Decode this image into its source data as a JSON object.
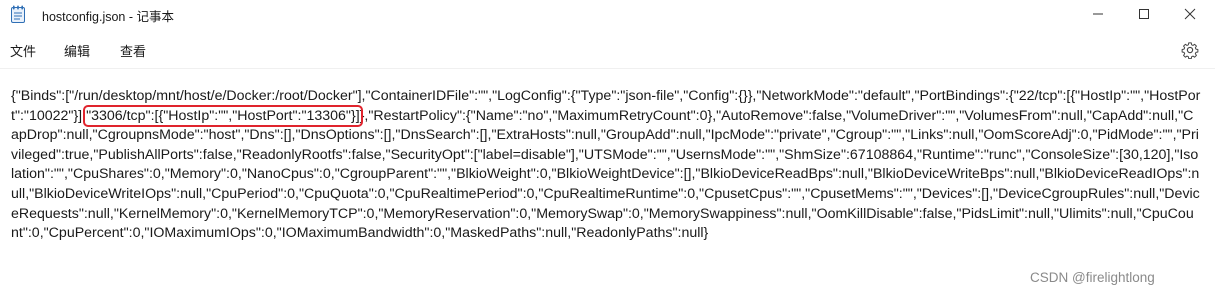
{
  "window": {
    "title": "hostconfig.json - 记事本",
    "icons": {
      "app": "notepad-icon",
      "minimize": "minimize-icon",
      "maximize": "maximize-icon",
      "close": "close-icon",
      "settings": "gear-icon"
    }
  },
  "menu": {
    "file": "文件",
    "edit": "编辑",
    "view": "查看"
  },
  "document": {
    "before_highlight": "{\"Binds\":[\"/run/desktop/mnt/host/e/Docker:/root/Docker\"],\"ContainerIDFile\":\"\",\"LogConfig\":{\"Type\":\"json-file\",\"Config\":{}},\"NetworkMode\":\"default\",\"PortBindings\":{\"22/tcp\":[{\"HostIp\":\"\",\"HostPort\":\"10022\"}],",
    "highlight": "\"3306/tcp\":[{\"HostIp\":\"\",\"HostPort\":\"13306\"}]",
    "after_highlight": "},\"RestartPolicy\":{\"Name\":\"no\",\"MaximumRetryCount\":0},\"AutoRemove\":false,\"VolumeDriver\":\"\",\"VolumesFrom\":null,\"CapAdd\":null,\"CapDrop\":null,\"CgroupnsMode\":\"host\",\"Dns\":[],\"DnsOptions\":[],\"DnsSearch\":[],\"ExtraHosts\":null,\"GroupAdd\":null,\"IpcMode\":\"private\",\"Cgroup\":\"\",\"Links\":null,\"OomScoreAdj\":0,\"PidMode\":\"\",\"Privileged\":true,\"PublishAllPorts\":false,\"ReadonlyRootfs\":false,\"SecurityOpt\":[\"label=disable\"],\"UTSMode\":\"\",\"UsernsMode\":\"\",\"ShmSize\":67108864,\"Runtime\":\"runc\",\"ConsoleSize\":[30,120],\"Isolation\":\"\",\"CpuShares\":0,\"Memory\":0,\"NanoCpus\":0,\"CgroupParent\":\"\",\"BlkioWeight\":0,\"BlkioWeightDevice\":[],\"BlkioDeviceReadBps\":null,\"BlkioDeviceWriteBps\":null,\"BlkioDeviceReadIOps\":null,\"BlkioDeviceWriteIOps\":null,\"CpuPeriod\":0,\"CpuQuota\":0,\"CpuRealtimePeriod\":0,\"CpuRealtimeRuntime\":0,\"CpusetCpus\":\"\",\"CpusetMems\":\"\",\"Devices\":[],\"DeviceCgroupRules\":null,\"DeviceRequests\":null,\"KernelMemory\":0,\"KernelMemoryTCP\":0,\"MemoryReservation\":0,\"MemorySwap\":0,\"MemorySwappiness\":null,\"OomKillDisable\":false,\"PidsLimit\":null,\"Ulimits\":null,\"CpuCount\":0,\"CpuPercent\":0,\"IOMaximumIOps\":0,\"IOMaximumBandwidth\":0,\"MaskedPaths\":null,\"ReadonlyPaths\":null}"
  },
  "watermark": "CSDN @firelightlong",
  "colors": {
    "highlight_border": "#e0242d",
    "background": "#ffffff"
  }
}
